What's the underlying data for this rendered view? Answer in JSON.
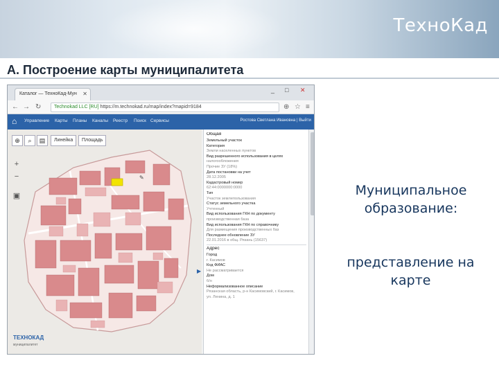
{
  "slide": {
    "logo": "ТехноКад",
    "title": "А. Построение карты муниципалитета",
    "caption_main": "Муниципальное образование:",
    "caption_sub": "представление на карте"
  },
  "browser": {
    "tab_title": "Каталог — ТехноКад-Мун",
    "url_security": "Technokad LLC [RU]",
    "url": "https://m.technokad.ru/map/index?mapid=9184",
    "window_controls": [
      "_",
      "□",
      "✕"
    ]
  },
  "app": {
    "menu": [
      "Управление",
      "Карты",
      "Планы",
      "Каналы",
      "Реестр",
      "Поиск",
      "Сервисы"
    ],
    "user_info": "Ростова Светлана Ивановна | Выйти",
    "map_tabs": [
      "Линейка",
      "Площадь"
    ],
    "map_logo": "ТЕХНОКАД",
    "map_logo_sub": "муниципалитет"
  },
  "panel": {
    "rows": [
      {
        "text": "Общая",
        "type": "section"
      },
      {
        "text": "Земельный участок",
        "type": "label"
      },
      {
        "text": "Категория",
        "type": "label"
      },
      {
        "text": "Земли населенных пунктов",
        "type": "value"
      },
      {
        "text": "Вид разрешенного использования в целях",
        "type": "label"
      },
      {
        "text": "налогообложения",
        "type": "value"
      },
      {
        "text": "Прочие ЗУ (18%)",
        "type": "edit"
      },
      {
        "text": "Дата постановки на учет",
        "type": "label"
      },
      {
        "text": "28.12.2005",
        "type": "value"
      },
      {
        "text": "Кадастровый номер",
        "type": "label"
      },
      {
        "text": "62:44:0000000:0000",
        "type": "value"
      },
      {
        "text": "Тип",
        "type": "label"
      },
      {
        "text": "Участок землепользования",
        "type": "value"
      },
      {
        "text": "Статус земельного участка",
        "type": "label"
      },
      {
        "text": "Учтенный",
        "type": "value"
      },
      {
        "text": "Вид использования ГКН по документу",
        "type": "label"
      },
      {
        "text": "производственная база",
        "type": "value"
      },
      {
        "text": "Вид использования ГКН по справочнику",
        "type": "label"
      },
      {
        "text": "Для размещения производственных баз",
        "type": "value"
      },
      {
        "text": "Последнее обновление ЗУ",
        "type": "label"
      },
      {
        "text": "22.01.2016 в общ. Рязань (15637)",
        "type": "value"
      },
      {
        "text": "Адрес",
        "type": "section"
      },
      {
        "text": "Город",
        "type": "label"
      },
      {
        "text": "г. Касимов",
        "type": "value"
      },
      {
        "text": "Код ФИАС",
        "type": "label"
      },
      {
        "text": "Не рассматривается",
        "type": "value"
      },
      {
        "text": "Дом",
        "type": "label"
      },
      {
        "text": "б/н",
        "type": "value"
      },
      {
        "text": "Неформализованное описание",
        "type": "label"
      },
      {
        "text": "Рязанская область, р-н Касимовский, г. Касимов,",
        "type": "value"
      },
      {
        "text": "ул. Ленина, д. 1",
        "type": "value"
      }
    ]
  }
}
